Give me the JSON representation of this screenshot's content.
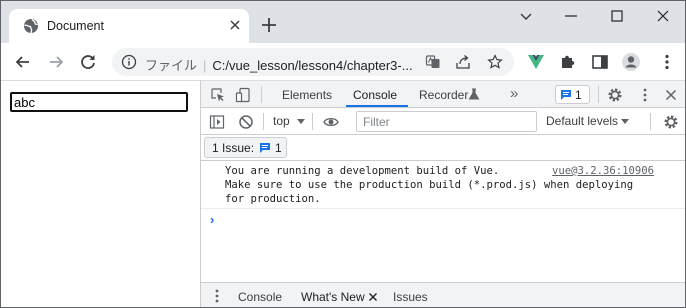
{
  "browser": {
    "tab_title": "Document",
    "url_label": "ファイル",
    "url_path": "C:/vue_lesson/lesson4/chapter3-..."
  },
  "page": {
    "input_value": "abc"
  },
  "devtools": {
    "tabs": [
      "Elements",
      "Console",
      "Recorder"
    ],
    "active_tab": "Console",
    "more_tabs": "»",
    "issue_badge_count": "1",
    "context_select": "top",
    "filter_placeholder": "Filter",
    "levels_select": "Default levels",
    "issues_label": "1 Issue:",
    "issues_count": "1",
    "console_lines": [
      "You are running a development build of Vue.",
      "Make sure to use the production build (*.prod.js) when deploying",
      "for production."
    ],
    "console_source": "vue@3.2.36:10906",
    "prompt": "›",
    "drawer_tabs": [
      "Console",
      "What's New",
      "Issues"
    ],
    "drawer_active": "What's New"
  },
  "colors": {
    "accent": "#1a73e8",
    "vue_green": "#41b883",
    "vue_dark": "#35495e",
    "tabstrip": "#dee1e6"
  },
  "icons": {
    "tab": "globe-icon",
    "close": "close-icon",
    "new_tab": "plus-icon",
    "back": "arrow-left-icon",
    "forward": "arrow-right-icon",
    "reload": "reload-icon",
    "info": "info-icon",
    "translate": "translate-icon",
    "share": "share-icon",
    "bookmark": "star-icon",
    "vue": "vue-devtools-icon",
    "extensions": "puzzle-icon",
    "side_panel": "side-panel-icon",
    "profile": "profile-icon",
    "menu": "kebab-menu-icon"
  }
}
